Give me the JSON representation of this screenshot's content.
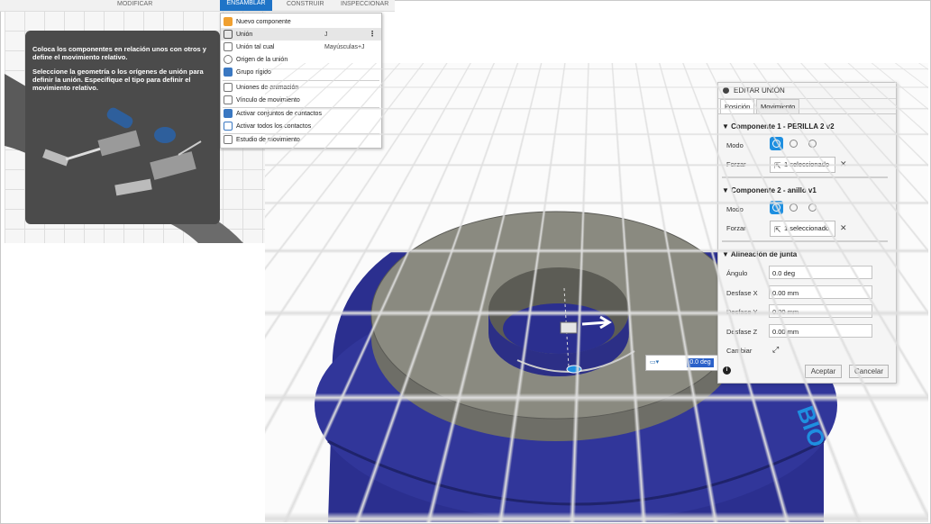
{
  "menubar": {
    "items": [
      "MODIFICAR",
      "ENSAMBLAR",
      "CONSTRUIR",
      "INSPECCIONAR"
    ],
    "active_index": 1
  },
  "dropdown": {
    "items": [
      {
        "label": "Nuevo componente",
        "icon": "new-component-icon",
        "shortcut": ""
      },
      {
        "label": "Unión",
        "icon": "joint-icon",
        "shortcut": "J",
        "highlighted": true
      },
      {
        "label": "Unión tal cual",
        "icon": "as-built-joint-icon",
        "shortcut": "Mayúsculas+J"
      },
      {
        "label": "Origen de la unión",
        "icon": "joint-origin-icon",
        "shortcut": ""
      },
      {
        "label": "Grupo rígido",
        "icon": "rigid-group-icon",
        "shortcut": ""
      },
      {
        "label": "Uniones de animación",
        "icon": "animate-joints-icon",
        "shortcut": ""
      },
      {
        "label": "Vínculo de movimiento",
        "icon": "motion-link-icon",
        "shortcut": ""
      },
      {
        "label": "Activar conjuntos de contactos",
        "icon": "contact-sets-icon",
        "shortcut": ""
      },
      {
        "label": "Activar todos los contactos",
        "icon": "all-contacts-icon",
        "shortcut": ""
      },
      {
        "label": "Estudio de movimiento",
        "icon": "motion-study-icon",
        "shortcut": ""
      }
    ]
  },
  "tooltip": {
    "line1": "Coloca los componentes en relación unos con otros y define el movimiento relativo.",
    "line2": "Seleccione la geometría o los orígenes de unión para definir la unión. Especifique el tipo para definir el movimiento relativo."
  },
  "dialog": {
    "title": "EDITAR UNIÓN",
    "tabs": [
      "Posición",
      "Movimiento"
    ],
    "comp1_header": "Componente 1 - PERILLA 2 v2",
    "comp2_header": "Componente 2 - anillo v1",
    "mode_label": "Modo",
    "snap_label": "Forzar",
    "selected_text": "1 seleccionado",
    "align_header": "Alineación de junta",
    "angle_label": "Ángulo",
    "angle_value": "0.0 deg",
    "offx_label": "Desfase X",
    "offx_value": "0.00 mm",
    "offy_label": "Desfase Y",
    "offy_value": "0.00 mm",
    "offz_label": "Desfase Z",
    "offz_value": "0.00 mm",
    "flip_label": "Cambiar",
    "ok_label": "Aceptar",
    "cancel_label": "Cancelar"
  },
  "manipulator": {
    "value": "0.0 deg"
  },
  "colors": {
    "accent": "#1e8fe0",
    "part_blue": "#2b2f8f",
    "part_gray": "#8a8a80"
  }
}
